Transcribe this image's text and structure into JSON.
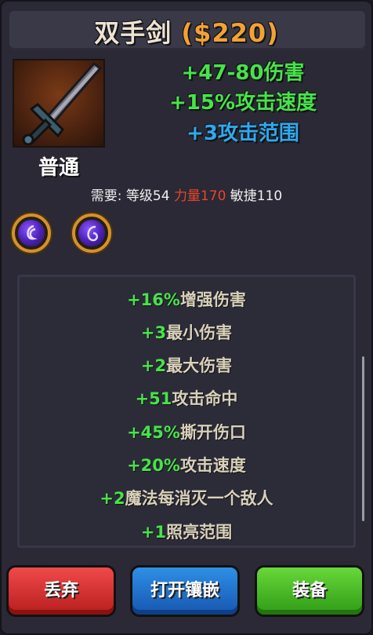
{
  "item": {
    "name": "双手剑",
    "price": "($220)",
    "rarity": "普通",
    "icon": "two-handed-sword-icon"
  },
  "base_stats": [
    {
      "text": "+47-80伤害",
      "color": "#47e34a"
    },
    {
      "text": "+15%攻击速度",
      "color": "#47e34a"
    },
    {
      "text": "+3攻击范围",
      "color": "#2fa8f0"
    }
  ],
  "requirements": {
    "label": "需要:",
    "level": "等级54",
    "strength": "力量170",
    "dexterity": "敏捷110"
  },
  "sockets": [
    {
      "icon": "purple-gem-icon"
    },
    {
      "icon": "purple-gem-icon"
    }
  ],
  "affixes": [
    {
      "value": "+16%",
      "label": "增强伤害"
    },
    {
      "value": "+3",
      "label": "最小伤害"
    },
    {
      "value": "+2",
      "label": "最大伤害"
    },
    {
      "value": "+51",
      "label": "攻击命中"
    },
    {
      "value": "+45%",
      "label": "撕开伤口"
    },
    {
      "value": "+20%",
      "label": "攻击速度"
    },
    {
      "value": "+2",
      "label": "魔法每消灭一个敌人"
    },
    {
      "value": "+1",
      "label": "照亮范围"
    }
  ],
  "buttons": {
    "discard": "丢弃",
    "open_socket": "打开镶嵌",
    "equip": "装备"
  },
  "colors": {
    "price": "#f2a233",
    "strength_requirement": "#e8452c",
    "affix_value": "#47e34a"
  }
}
